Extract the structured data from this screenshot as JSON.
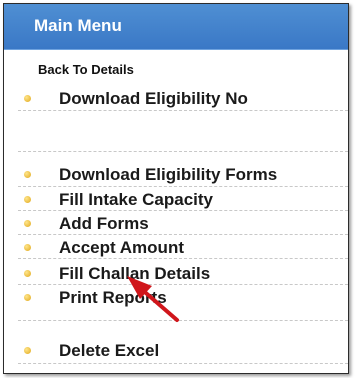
{
  "menu": {
    "title": "Main Menu",
    "back_label": "Back To Details",
    "items": [
      {
        "label": "Download Eligibility No"
      },
      {
        "label": "Download Eligibility Forms"
      },
      {
        "label": "Fill Intake Capacity"
      },
      {
        "label": "Add Forms"
      },
      {
        "label": "Accept Amount"
      },
      {
        "label": "Fill Challan Details"
      },
      {
        "label": "Print Reports"
      },
      {
        "label": "Delete Excel"
      }
    ]
  },
  "colors": {
    "header": "#3f7fcc",
    "bullet": "#e0a81c",
    "arrow": "#d0161b"
  }
}
